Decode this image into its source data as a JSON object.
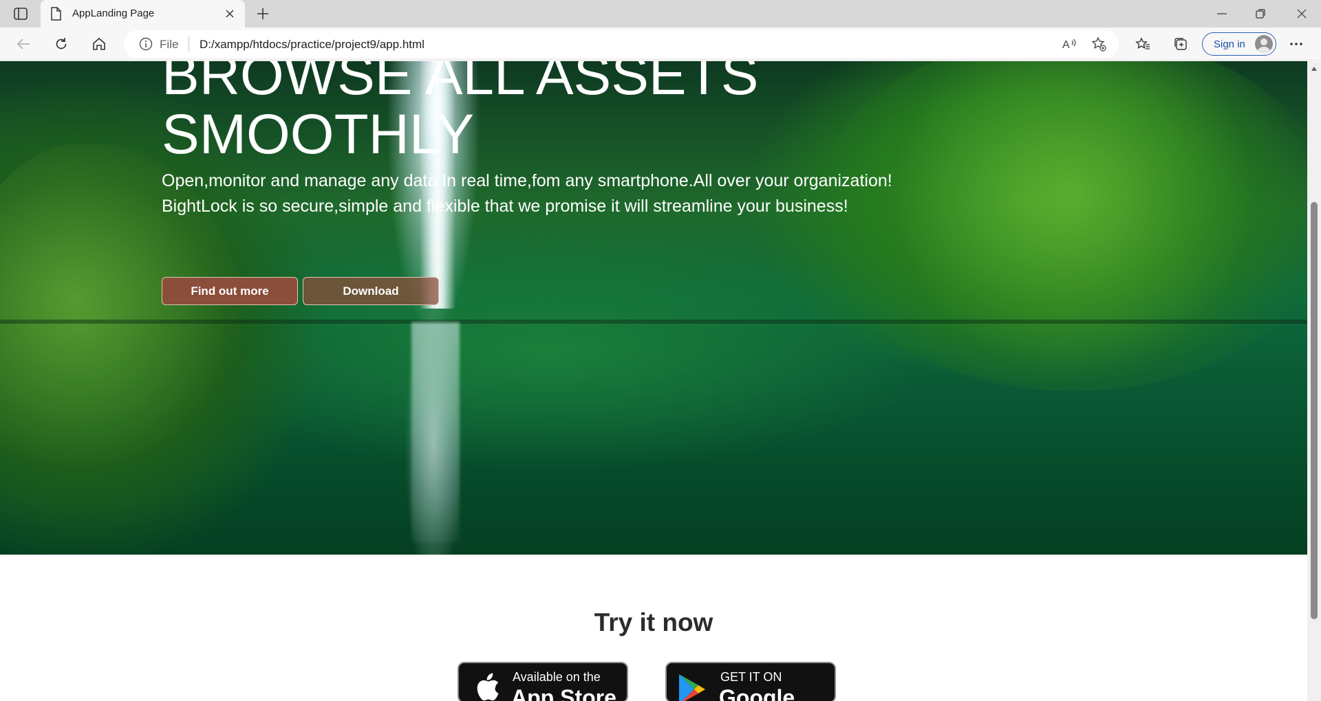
{
  "browser": {
    "tab_title": "AppLanding Page",
    "address_scheme": "File",
    "address_url": "D:/xampp/htdocs/practice/project9/app.html",
    "sign_in_label": "Sign in",
    "accent_color": "#2a5fb8"
  },
  "hero": {
    "title_line1": "BROWSE ALL ASSETS",
    "title_line2": "SMOOTHLY",
    "text_line1": "Open,monitor and manage any data In real time,fom any smartphone.All over your organization!",
    "text_line2": "BightLock is so secure,simple and flexible that we promise it will streamline your business!",
    "button_find_out_more": "Find out more",
    "button_download": "Download",
    "button_color": "#8b4e3a"
  },
  "try_section": {
    "title": "Try it now",
    "app_store_small": "Available on the",
    "app_store_big": "App Store",
    "google_play_small": "GET IT ON",
    "google_play_big": "Google Play"
  }
}
